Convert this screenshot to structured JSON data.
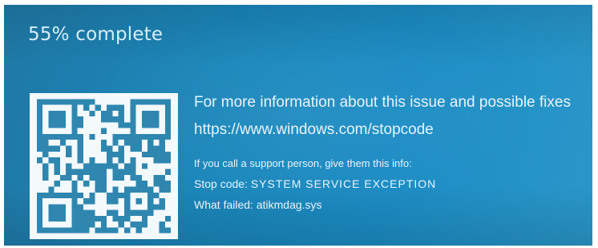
{
  "progress_text": "55% complete",
  "qr_code": {
    "icon": "qr-code-icon",
    "color": "#2f87b0",
    "background": "#f4f9fb"
  },
  "more_info_text": "For more information about this issue and possible fixes",
  "stopcode_url": "https://www.windows.com/stopcode",
  "support_text": "If you call a support person, give them this info:",
  "stop_code": {
    "label": "Stop code:",
    "value": "SYSTEM SERVICE EXCEPTION"
  },
  "what_failed": {
    "label": "What failed:",
    "value": "atikmdag.sys"
  },
  "colors": {
    "background": "#1b86bb",
    "text": "#e7f4fb"
  }
}
